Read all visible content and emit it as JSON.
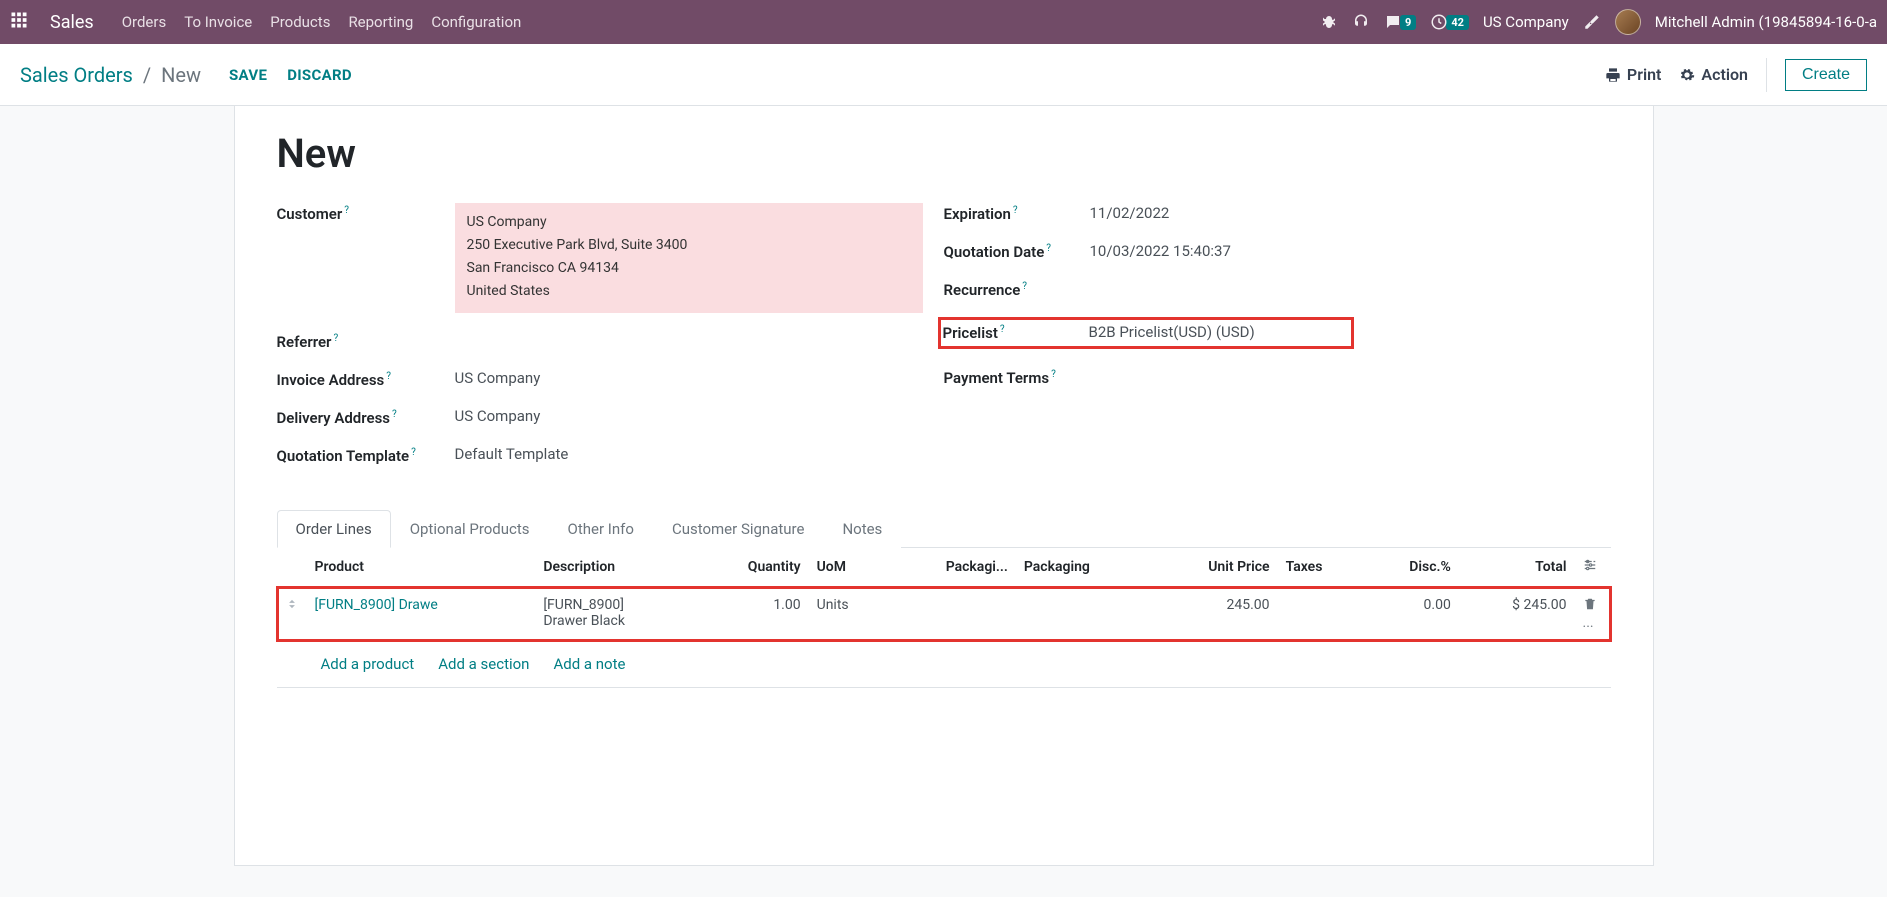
{
  "topbar": {
    "brand": "Sales",
    "nav": [
      "Orders",
      "To Invoice",
      "Products",
      "Reporting",
      "Configuration"
    ],
    "msg_badge": "9",
    "act_badge": "42",
    "company": "US Company",
    "user": "Mitchell Admin (19845894-16-0-a"
  },
  "ctrlbar": {
    "bc_root": "Sales Orders",
    "bc_current": "New",
    "save": "SAVE",
    "discard": "DISCARD",
    "print": "Print",
    "action": "Action",
    "create": "Create"
  },
  "form": {
    "title": "New",
    "labels": {
      "customer": "Customer",
      "referrer": "Referrer",
      "invoice_addr": "Invoice Address",
      "delivery_addr": "Delivery Address",
      "quote_tpl": "Quotation Template",
      "expiration": "Expiration",
      "quote_date": "Quotation Date",
      "recurrence": "Recurrence",
      "pricelist": "Pricelist",
      "payment_terms": "Payment Terms"
    },
    "customer": {
      "name": "US Company",
      "street": "250 Executive Park Blvd, Suite 3400",
      "city": "San Francisco CA 94134",
      "country": "United States"
    },
    "invoice_addr": "US Company",
    "delivery_addr": "US Company",
    "quote_tpl": "Default Template",
    "expiration": "11/02/2022",
    "quote_date": "10/03/2022 15:40:37",
    "pricelist": "B2B Pricelist(USD) (USD)"
  },
  "tabs": [
    "Order Lines",
    "Optional Products",
    "Other Info",
    "Customer Signature",
    "Notes"
  ],
  "orderlines": {
    "headers": {
      "product": "Product",
      "description": "Description",
      "quantity": "Quantity",
      "uom": "UoM",
      "packagi": "Packagi...",
      "packaging": "Packaging",
      "unit_price": "Unit Price",
      "taxes": "Taxes",
      "disc": "Disc.%",
      "total": "Total"
    },
    "rows": [
      {
        "product": "[FURN_8900] Drawe",
        "description": "[FURN_8900]\nDrawer Black",
        "qty": "1.00",
        "uom": "Units",
        "unit_price": "245.00",
        "disc": "0.00",
        "total": "$ 245.00"
      }
    ],
    "add_product": "Add a product",
    "add_section": "Add a section",
    "add_note": "Add a note"
  }
}
